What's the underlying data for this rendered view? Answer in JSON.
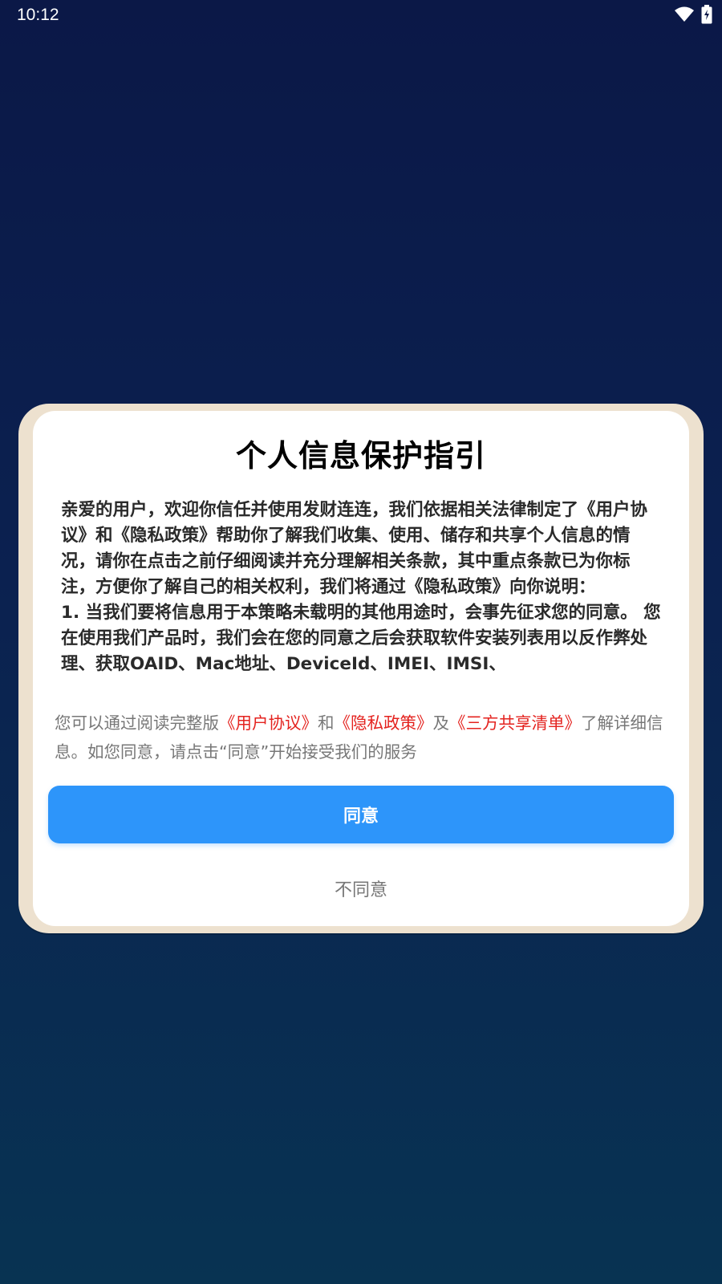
{
  "status_bar": {
    "time": "10:12",
    "icons": [
      "wifi-icon",
      "battery-charging-icon"
    ]
  },
  "dialog": {
    "title": "个人信息保护指引",
    "policy_text": "亲爱的用户，欢迎你信任并使用发财连连，我们依据相关法律制定了《用户协议》和《隐私政策》帮助你了解我们收集、使用、储存和共享个人信息的情况，请你在点击之前仔细阅读并充分理解相关条款，其中重点条款已为你标注，方便你了解自己的相关权利，我们将通过《隐私政策》向你说明：\n1. 当我们要将信息用于本策略未载明的其他用途时，会事先征求您的同意。 您在使用我们产品时，我们会在您的同意之后会获取软件安装列表用以反作弊处理、获取OAID、Mac地址、DeviceId、IMEI、IMSI、",
    "summary": {
      "prefix": "您可以通过阅读完整版",
      "link_user_agreement": "《用户协议》",
      "and": "和",
      "link_privacy_policy": "《隐私政策》",
      "also": "及",
      "link_third_party": "《三方共享清单》",
      "suffix": "了解详细信息。如您同意，请点击“同意”开始接受我们的服务"
    },
    "agree_label": "同意",
    "disagree_label": "不同意"
  },
  "colors": {
    "background_top": "#0b1847",
    "background_bottom": "#083352",
    "frame": "#ede1cf",
    "agree_button": "#2d95fa",
    "link": "#e4231f",
    "muted_text": "#777777"
  }
}
